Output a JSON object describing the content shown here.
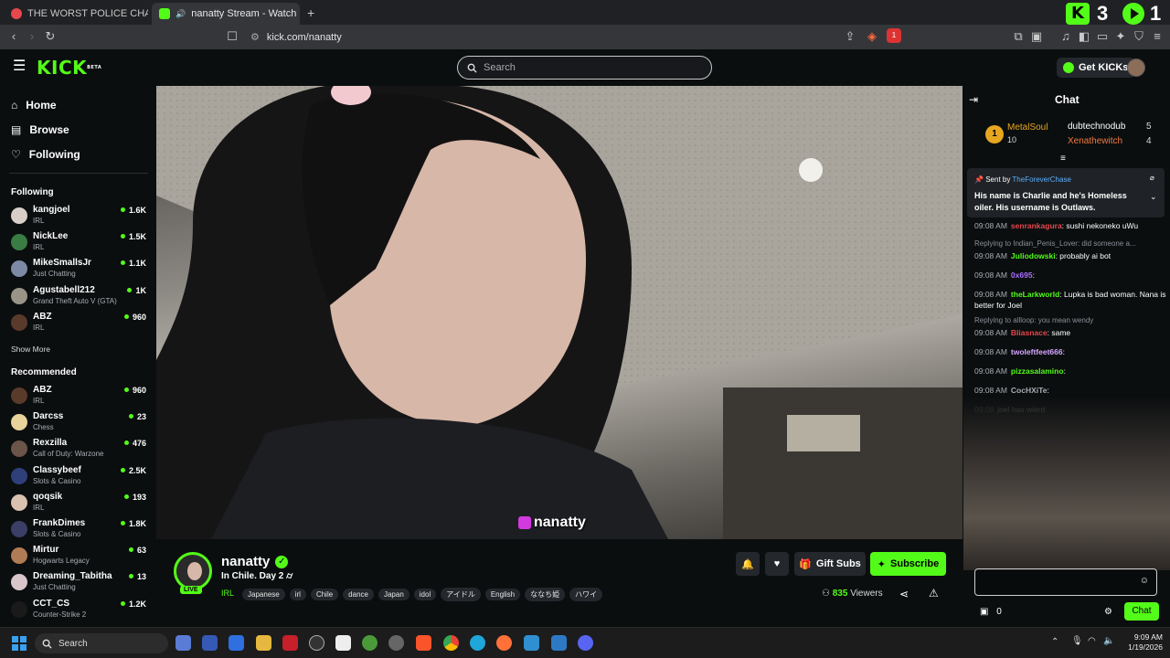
{
  "browser": {
    "tabs": [
      {
        "title": "THE WORST POLICE CHASE I'VE EVER"
      },
      {
        "title": "nanatty Stream - Watch Live o"
      }
    ],
    "url": "kick.com/nanatty",
    "badge_count": "1"
  },
  "overlay_badges": {
    "count_left": "3",
    "count_right": "1"
  },
  "header": {
    "logo": "KICK",
    "logo_sup": "BETA",
    "search_placeholder": "Search",
    "get_kicks": "Get KICKs"
  },
  "sidebar": {
    "nav": [
      {
        "label": "Home",
        "icon": "home-icon"
      },
      {
        "label": "Browse",
        "icon": "browse-icon"
      },
      {
        "label": "Following",
        "icon": "heart-icon"
      }
    ],
    "following_title": "Following",
    "following": [
      {
        "name": "kangjoel",
        "category": "IRL",
        "viewers": "1.6K",
        "color": "#d8d0c8"
      },
      {
        "name": "NickLee",
        "category": "IRL",
        "viewers": "1.5K",
        "color": "#3a7d44"
      },
      {
        "name": "MikeSmallsJr",
        "category": "Just Chatting",
        "viewers": "1.1K",
        "color": "#7d8aa6"
      },
      {
        "name": "Agustabell212",
        "category": "Grand Theft Auto V (GTA)",
        "viewers": "1K",
        "color": "#9a9486"
      },
      {
        "name": "ABZ",
        "category": "IRL",
        "viewers": "960",
        "color": "#5a3a2a"
      }
    ],
    "show_more": "Show More",
    "recommended_title": "Recommended",
    "recommended": [
      {
        "name": "ABZ",
        "category": "IRL",
        "viewers": "960",
        "color": "#5a3a2a"
      },
      {
        "name": "Darcss",
        "category": "Chess",
        "viewers": "23",
        "color": "#e8d39a"
      },
      {
        "name": "Rexzilla",
        "category": "Call of Duty: Warzone",
        "viewers": "476",
        "color": "#6b5449"
      },
      {
        "name": "Classybeef",
        "category": "Slots & Casino",
        "viewers": "2.5K",
        "color": "#2f3f7a"
      },
      {
        "name": "qoqsik",
        "category": "IRL",
        "viewers": "193",
        "color": "#d9c2b0"
      },
      {
        "name": "FrankDimes",
        "category": "Slots & Casino",
        "viewers": "1.8K",
        "color": "#3b3e66"
      },
      {
        "name": "Mirtur",
        "category": "Hogwarts Legacy",
        "viewers": "63",
        "color": "#b07b55"
      },
      {
        "name": "Dreaming_Tabitha",
        "category": "Just Chatting",
        "viewers": "13",
        "color": "#d8c6cb"
      },
      {
        "name": "CCT_CS",
        "category": "Counter-Strike 2",
        "viewers": "1.2K",
        "color": "#1a1a1a"
      }
    ]
  },
  "video": {
    "watermark": "nanatty"
  },
  "stream": {
    "name": "nanatty",
    "title": "In Chile. Day 2",
    "live": "LIVE",
    "category": "IRL",
    "tags": [
      "Japanese",
      "irl",
      "Chile",
      "dance",
      "Japan",
      "idol",
      "アイドル",
      "English",
      "ななち姫",
      "ハワイ"
    ],
    "gift_subs": "Gift Subs",
    "subscribe": "Subscribe",
    "viewers": "835",
    "viewers_label": "Viewers"
  },
  "chat": {
    "title": "Chat",
    "leaderboard": {
      "rank": "1",
      "top_user": "MetalSoul",
      "top_count": "10",
      "second_user": "dubtechnodub",
      "second_count": "5",
      "third_user": "Xenathewitch",
      "third_count": "4"
    },
    "pinned": {
      "sent_by": "Sent by",
      "sender": "TheForeverChase",
      "text": "His name is Charlie and he's Homeless oiler. His username is Outlaws."
    },
    "messages": [
      {
        "time": "09:08 AM",
        "user": "senrankagura",
        "text": ": sushi nekoneko uWu",
        "color": "#e5484d"
      },
      {
        "reply": "Replying to Indian_Penis_Lover: did someone a..."
      },
      {
        "time": "09:08 AM",
        "user": "Juliodowski",
        "text": ": probably ai bot",
        "color": "#53fc18"
      },
      {
        "time": "09:08 AM",
        "user": "0x695",
        "text": ":",
        "color": "#a970ff"
      },
      {
        "time": "09:08 AM",
        "user": "theLarkworld",
        "text": ": Lupka is bad woman. Nana is better for Joel",
        "color": "#53fc18"
      },
      {
        "reply": "Replying to allloop: you mean wendy"
      },
      {
        "time": "09:08 AM",
        "user": "Bliasnace",
        "text": ": same",
        "color": "#e5484d"
      },
      {
        "time": "09:08 AM",
        "user": "twoleftfeet666",
        "text": ":",
        "color": "#d6a5ff"
      },
      {
        "time": "09:08 AM",
        "user": "pizzasalamino",
        "text": ":",
        "color": "#53fc18"
      },
      {
        "time": "09:08 AM",
        "user": "CocHXiTe",
        "text": ":",
        "color": "#a9adb3"
      },
      {
        "time": "09:08",
        "user": "",
        "text": "joel has wierd",
        "color": "#a9adb3"
      }
    ],
    "bottom_count": "0",
    "chat_button": "Chat"
  },
  "taskbar": {
    "search": "Search",
    "time": "9:09 AM",
    "date": "1/19/2026"
  }
}
